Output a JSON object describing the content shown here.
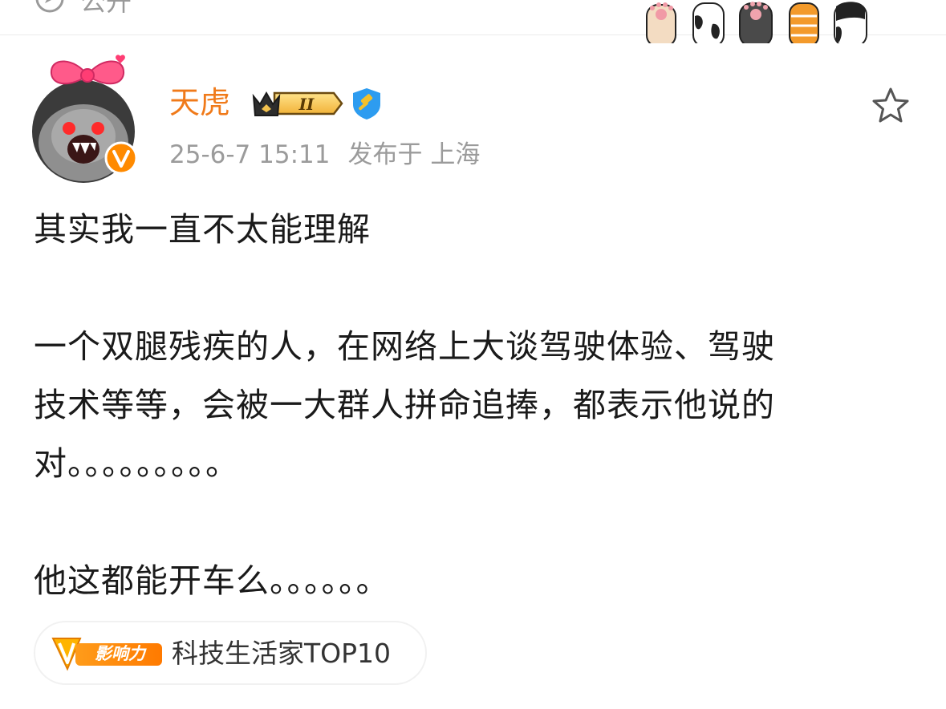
{
  "header": {
    "visibility_label": "公开"
  },
  "post": {
    "author": {
      "name": "天虎"
    },
    "meta": {
      "timestamp": "25-6-7 15:11",
      "location": "发布于 上海"
    },
    "paragraphs": [
      "其实我一直不太能理解",
      "一个双腿残疾的人，在网络上大谈驾驶体验、驾驶",
      "技术等等，会被一大群人拼命追捧，都表示他说的",
      "对。。。。。。。。。",
      "他这都能开车么。。。。。。"
    ],
    "badge_chip": {
      "icon_text": "影响力",
      "label": "科技生活家TOP10"
    }
  },
  "colors": {
    "username": "#f07a1a",
    "meta_gray": "#9b9b9b",
    "body_text": "#1a1a1a",
    "vip_orange": "#ff8a00",
    "verify_blue": "#2d9cf0"
  },
  "icons": {
    "visibility": "globe-icon",
    "crown_badge": "crown-level-badge-icon",
    "verify": "gavel-verified-icon",
    "favorite": "star-outline-icon",
    "vip": "vip-v-icon",
    "paws": "cat-paws-decoration"
  }
}
